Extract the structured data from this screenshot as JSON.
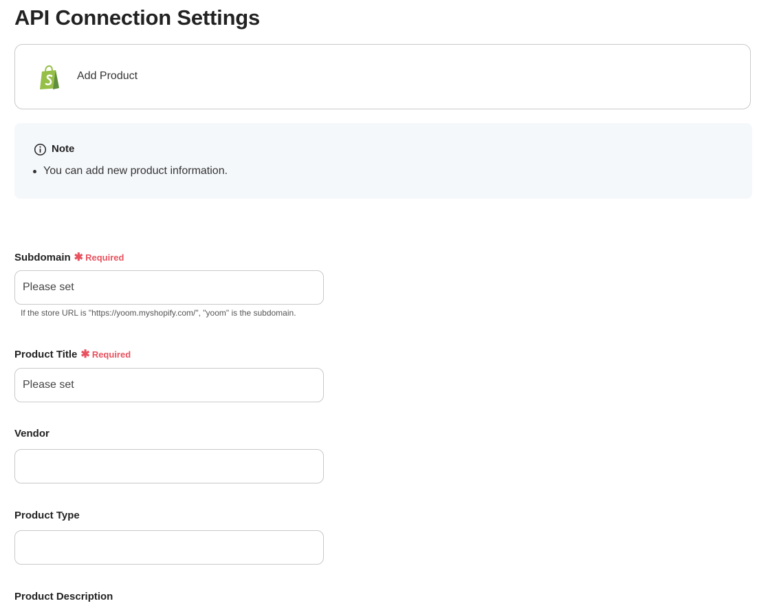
{
  "page": {
    "title": "API Connection Settings"
  },
  "action": {
    "label": "Add Product",
    "icon": "shopify-logo-icon",
    "brand_color": "#95bf47"
  },
  "note": {
    "title": "Note",
    "icon": "info-circle-icon",
    "items": [
      "You can add new product information."
    ]
  },
  "required_color": "#e8525f",
  "fields": [
    {
      "label": "Subdomain",
      "required": true,
      "required_label": "Required",
      "value": "",
      "placeholder": "Please set",
      "help": "If the store URL is \"https://yoom.myshopify.com/\", \"yoom\" is the subdomain."
    },
    {
      "label": "Product Title",
      "required": true,
      "required_label": "Required",
      "value": "",
      "placeholder": "Please set"
    },
    {
      "label": "Vendor",
      "required": false,
      "value": "",
      "placeholder": ""
    },
    {
      "label": "Product Type",
      "required": false,
      "value": "",
      "placeholder": ""
    },
    {
      "label": "Product Description",
      "required": false
    }
  ]
}
